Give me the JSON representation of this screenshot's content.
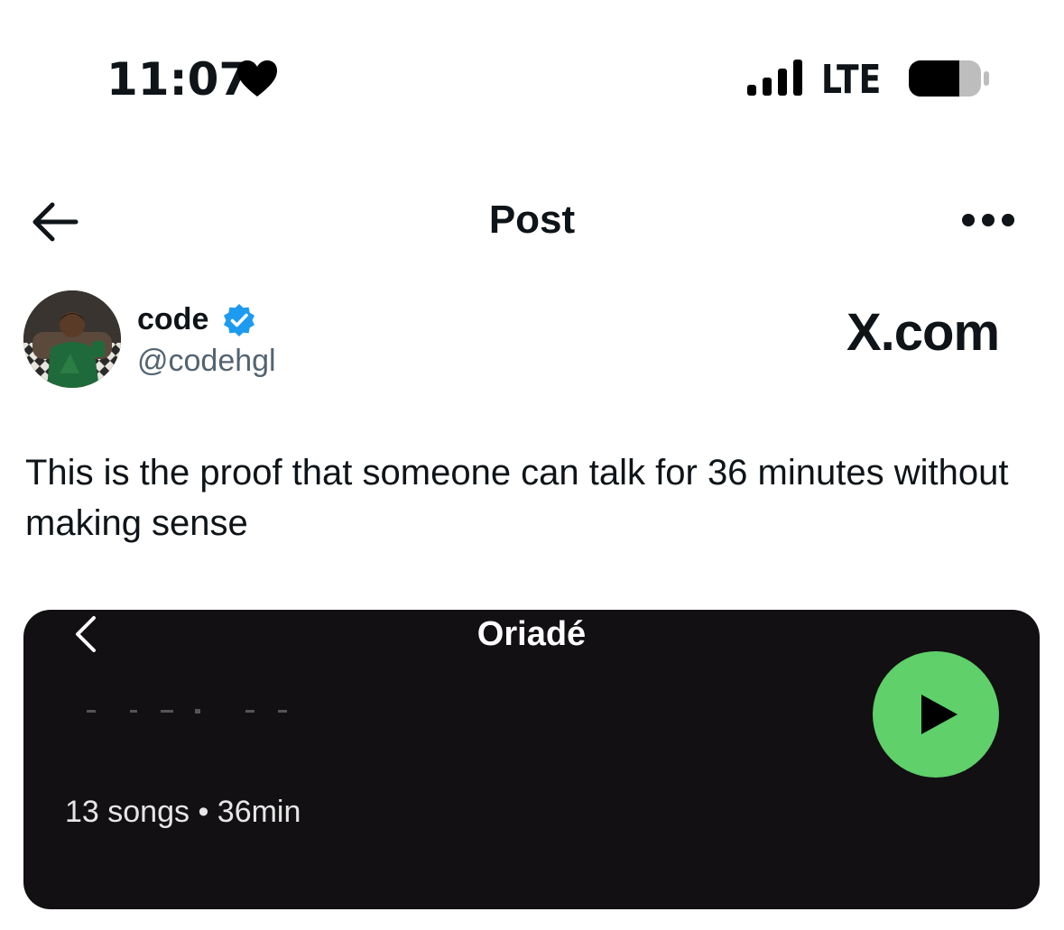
{
  "status_bar": {
    "time": "11:07",
    "carrier": "LTE",
    "icons": [
      "heart-icon",
      "signal-bars-icon",
      "battery-icon"
    ]
  },
  "header": {
    "title": "Post",
    "icons": [
      "back-arrow-icon",
      "more-options-icon"
    ]
  },
  "author": {
    "display_name": "code",
    "handle": "@codehgl",
    "verified": true
  },
  "watermark": "X.com",
  "post": {
    "text": "This is the proof that someone can talk for 36 minutes without making sense"
  },
  "media": {
    "playlist_title": "Oriadé",
    "meta": "13 songs • 36min",
    "icons": [
      "chevron-left-icon",
      "play-icon"
    ]
  },
  "colors": {
    "text_primary": "#0f1419",
    "text_secondary": "#536471",
    "verified_blue": "#1d9bf0",
    "media_background": "#121012",
    "play_green": "#5fd06a"
  }
}
